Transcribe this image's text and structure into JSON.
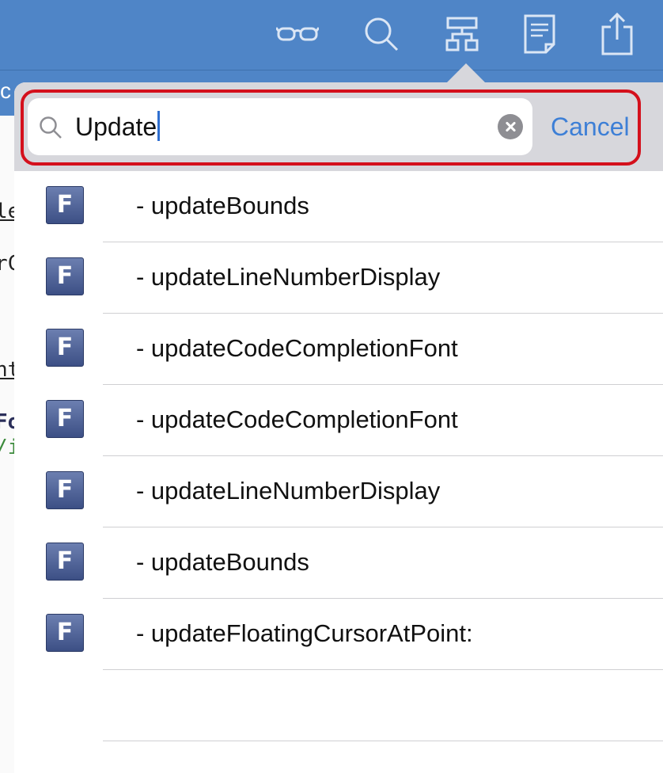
{
  "toolbar": {
    "icons": [
      "glasses-icon",
      "search-icon",
      "hierarchy-icon",
      "document-icon",
      "share-icon"
    ]
  },
  "subbar": {
    "text": "c"
  },
  "editor": {
    "lines": [
      "le",
      "rC",
      "nt",
      "Fo",
      "/i"
    ]
  },
  "search": {
    "value": "Update",
    "cancel_label": "Cancel"
  },
  "results": [
    {
      "badge": "F",
      "label": "- updateBounds"
    },
    {
      "badge": "F",
      "label": "- updateLineNumberDisplay"
    },
    {
      "badge": "F",
      "label": "- updateCodeCompletionFont"
    },
    {
      "badge": "F",
      "label": "- updateCodeCompletionFont"
    },
    {
      "badge": "F",
      "label": "- updateLineNumberDisplay"
    },
    {
      "badge": "F",
      "label": "- updateBounds"
    },
    {
      "badge": "F",
      "label": "- updateFloatingCursorAtPoint:"
    }
  ],
  "colors": {
    "toolbar_bg": "#4f85c7",
    "accent": "#3d7fd6",
    "highlight_border": "#d4101c",
    "badge_bg": "#4a5d92"
  }
}
